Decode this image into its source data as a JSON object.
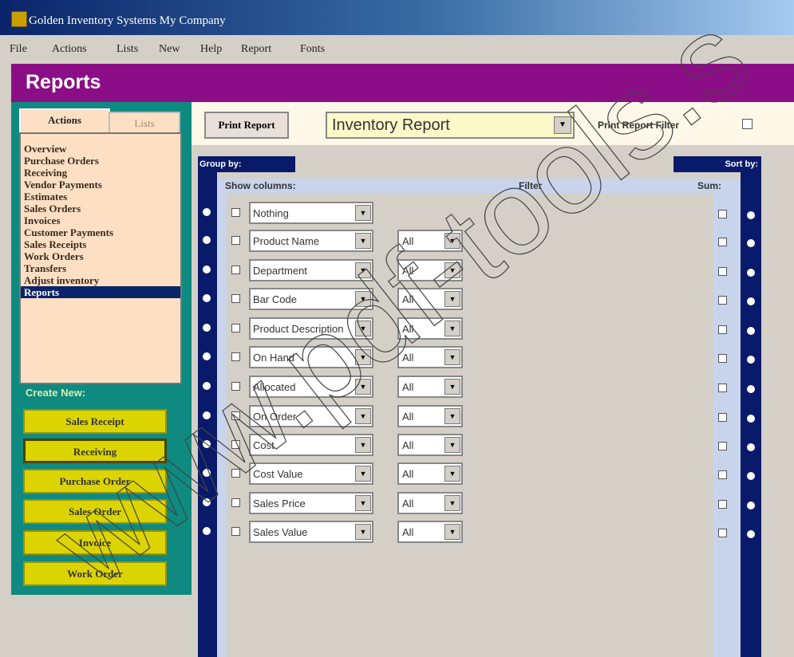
{
  "window": {
    "title": "Golden Inventory Systems My Company"
  },
  "menu": [
    "File",
    "Actions",
    "Lists",
    "New",
    "Help",
    "Report",
    "Fonts"
  ],
  "header": {
    "title": "Reports"
  },
  "sidebar": {
    "tabs": {
      "actions": "Actions",
      "lists": "Lists"
    },
    "items": [
      "Overview",
      "Purchase Orders",
      "Receiving",
      "Vendor Payments",
      "Estimates",
      "Sales Orders",
      "Invoices",
      "Customer Payments",
      "Sales Receipts",
      "Work Orders",
      "Transfers",
      "Adjust inventory",
      "Reports"
    ],
    "selected_item": "Reports",
    "create_new_label": "Create New:",
    "create_buttons": [
      "Sales Receipt",
      "Receiving",
      "Purchase Order",
      "Sales Order",
      "Invoice",
      "Work Order"
    ]
  },
  "toolbar": {
    "print_report_label": "Print Report",
    "report_select_value": "Inventory Report",
    "print_report_filter_label": "Print Report Filter",
    "print_report_filter_checked": false
  },
  "grid": {
    "group_by_label": "Group by:",
    "sort_by_label": "Sort by:",
    "show_columns_label": "Show columns:",
    "filter_label": "Filter",
    "sum_label": "Sum:",
    "rows": [
      {
        "field": "Nothing",
        "filter": ""
      },
      {
        "field": "Product Name",
        "filter": "All"
      },
      {
        "field": "Department",
        "filter": "All"
      },
      {
        "field": "Bar Code",
        "filter": "All"
      },
      {
        "field": "Product Description",
        "filter": "All"
      },
      {
        "field": "On Hand",
        "filter": "All"
      },
      {
        "field": "Allocated",
        "filter": "All"
      },
      {
        "field": "On Order",
        "filter": "All"
      },
      {
        "field": "Cost",
        "filter": "All"
      },
      {
        "field": "Cost Value",
        "filter": "All"
      },
      {
        "field": "Sales Price",
        "filter": "All"
      },
      {
        "field": "Sales Value",
        "filter": "All"
      }
    ]
  },
  "watermark": "www.pdf-tools.s",
  "colors": {
    "header": "#8c0e86",
    "sidebar": "#0e8a80",
    "list_bg": "#fde0c4",
    "create_button": "#dcd400",
    "strip": "#0a1a6a"
  }
}
